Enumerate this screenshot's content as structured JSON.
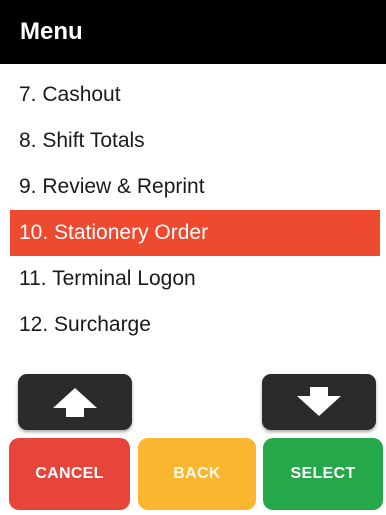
{
  "header": {
    "title": "Menu"
  },
  "menu": {
    "items": [
      {
        "label": "7. Cashout",
        "selected": false
      },
      {
        "label": "8. Shift Totals",
        "selected": false
      },
      {
        "label": "9. Review & Reprint",
        "selected": false
      },
      {
        "label": "10. Stationery Order",
        "selected": true
      },
      {
        "label": "11. Terminal Logon",
        "selected": false
      },
      {
        "label": "12. Surcharge",
        "selected": false
      }
    ]
  },
  "nav": {
    "up_icon": "arrow-up-icon",
    "down_icon": "arrow-down-icon"
  },
  "actions": {
    "cancel_label": "CANCEL",
    "back_label": "BACK",
    "select_label": "SELECT"
  },
  "colors": {
    "header_bg": "#000000",
    "selected_bg": "#ed4a30",
    "cancel": "#e8453a",
    "back": "#fbb62f",
    "select": "#25a84a",
    "arrow_bg": "#2b2b2b"
  }
}
